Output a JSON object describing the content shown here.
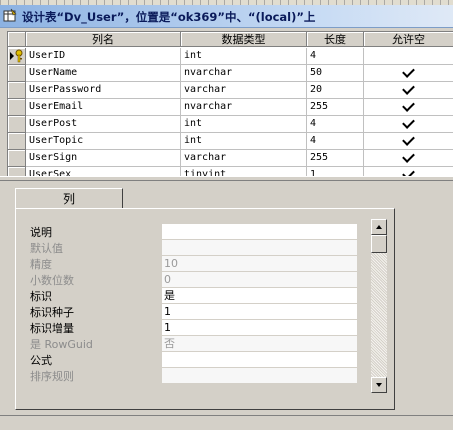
{
  "window": {
    "title": "设计表“Dv_User”，位置是“ok369”中、“(local)”上"
  },
  "grid": {
    "headers": [
      "列名",
      "数据类型",
      "长度",
      "允许空"
    ],
    "rows": [
      {
        "name": "UserID",
        "type": "int",
        "length": "4",
        "nullable": false,
        "key": true
      },
      {
        "name": "UserName",
        "type": "nvarchar",
        "length": "50",
        "nullable": true,
        "key": false
      },
      {
        "name": "UserPassword",
        "type": "varchar",
        "length": "20",
        "nullable": true,
        "key": false
      },
      {
        "name": "UserEmail",
        "type": "nvarchar",
        "length": "255",
        "nullable": true,
        "key": false
      },
      {
        "name": "UserPost",
        "type": "int",
        "length": "4",
        "nullable": true,
        "key": false
      },
      {
        "name": "UserTopic",
        "type": "int",
        "length": "4",
        "nullable": true,
        "key": false
      },
      {
        "name": "UserSign",
        "type": "varchar",
        "length": "255",
        "nullable": true,
        "key": false
      },
      {
        "name": "UserSex",
        "type": "tinyint",
        "length": "1",
        "nullable": true,
        "key": false
      }
    ]
  },
  "props": {
    "tab_label": "列",
    "items": [
      {
        "label": "说明",
        "value": "",
        "disabled": false
      },
      {
        "label": "默认值",
        "value": "",
        "disabled": true
      },
      {
        "label": "精度",
        "value": "10",
        "disabled": true
      },
      {
        "label": "小数位数",
        "value": "0",
        "disabled": true
      },
      {
        "label": "标识",
        "value": "是",
        "disabled": false
      },
      {
        "label": "标识种子",
        "value": "1",
        "disabled": false
      },
      {
        "label": "标识增量",
        "value": "1",
        "disabled": false
      },
      {
        "label": "是 RowGuid",
        "value": "否",
        "disabled": true
      },
      {
        "label": "公式",
        "value": "",
        "disabled": false
      },
      {
        "label": "排序规则",
        "value": "",
        "disabled": true
      }
    ]
  },
  "icons": {
    "window": "table-design-icon",
    "key": "primary-key-icon",
    "row_pointer": "current-row-arrow-icon"
  }
}
